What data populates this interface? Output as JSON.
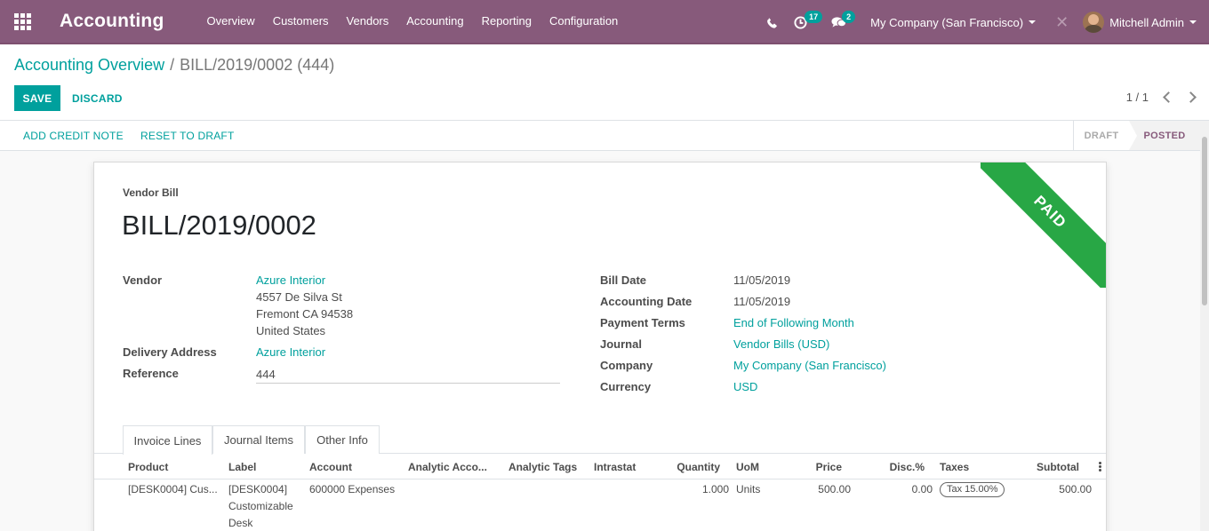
{
  "navbar": {
    "brand": "Accounting",
    "menu": [
      "Overview",
      "Customers",
      "Vendors",
      "Accounting",
      "Reporting",
      "Configuration"
    ],
    "activities_count": "17",
    "messages_count": "2",
    "company": "My Company (San Francisco)",
    "user": "Mitchell Admin"
  },
  "breadcrumb": {
    "parent": "Accounting Overview",
    "current": "BILL/2019/0002 (444)"
  },
  "toolbar": {
    "save_label": "SAVE",
    "discard_label": "DISCARD",
    "pager": "1 / 1"
  },
  "statusbar": {
    "add_credit_note": "ADD CREDIT NOTE",
    "reset_to_draft": "RESET TO DRAFT",
    "stages": [
      "DRAFT",
      "POSTED"
    ],
    "active_stage": "POSTED"
  },
  "sheet": {
    "ribbon": "PAID",
    "doc_type": "Vendor Bill",
    "doc_name": "BILL/2019/0002",
    "left_fields": {
      "vendor_label": "Vendor",
      "vendor_name": "Azure Interior",
      "vendor_street": "4557 De Silva St",
      "vendor_city": "Fremont CA 94538",
      "vendor_country": "United States",
      "delivery_label": "Delivery Address",
      "delivery_value": "Azure Interior",
      "reference_label": "Reference",
      "reference_value": "444"
    },
    "right_fields": [
      {
        "label": "Bill Date",
        "value": "11/05/2019"
      },
      {
        "label": "Accounting Date",
        "value": "11/05/2019"
      },
      {
        "label": "Payment Terms",
        "value": "End of Following Month"
      },
      {
        "label": "Journal",
        "value": "Vendor Bills (USD)"
      },
      {
        "label": "Company",
        "value": "My Company (San Francisco)"
      },
      {
        "label": "Currency",
        "value": "USD"
      }
    ],
    "tabs": [
      "Invoice Lines",
      "Journal Items",
      "Other Info"
    ],
    "active_tab": "Invoice Lines",
    "columns": [
      "Product",
      "Label",
      "Account",
      "Analytic Acco...",
      "Analytic Tags",
      "Intrastat",
      "Quantity",
      "UoM",
      "Price",
      "Disc.%",
      "Taxes",
      "Subtotal"
    ],
    "rows": [
      {
        "product": "[DESK0004] Cus...",
        "label_line1": "[DESK0004]",
        "label_line2": "Customizable",
        "label_line3": "Desk",
        "account": "600000 Expenses",
        "quantity": "1.000",
        "uom": "Units",
        "price": "500.00",
        "discount": "0.00",
        "tax": "Tax 15.00%",
        "subtotal": "500.00"
      }
    ]
  },
  "colors": {
    "navbar": "#875a7b",
    "accent": "#00a09d",
    "ribbon": "#28a745"
  }
}
